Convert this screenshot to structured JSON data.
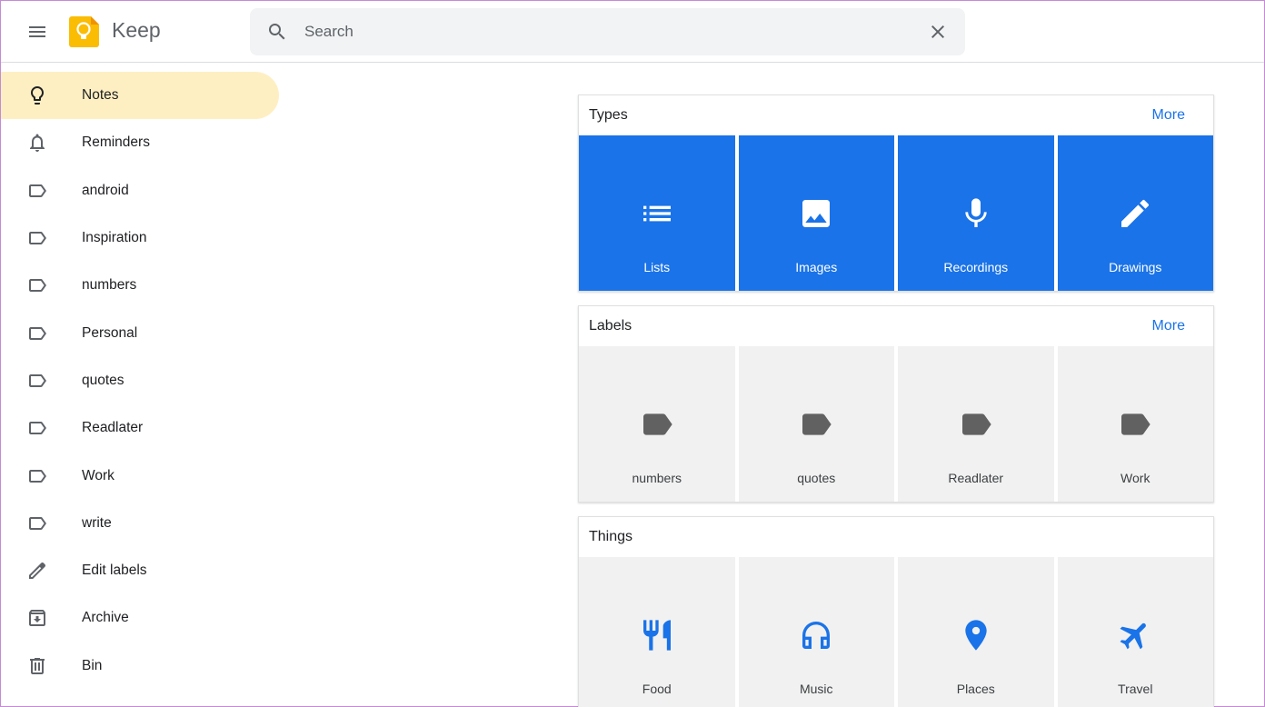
{
  "app": {
    "title": "Keep"
  },
  "search": {
    "placeholder": "Search",
    "value": ""
  },
  "sidebar": {
    "items": [
      {
        "label": "Notes",
        "icon": "lightbulb-icon",
        "active": true
      },
      {
        "label": "Reminders",
        "icon": "bell-icon"
      },
      {
        "label": "android",
        "icon": "label-icon"
      },
      {
        "label": "Inspiration",
        "icon": "label-icon"
      },
      {
        "label": "numbers",
        "icon": "label-icon"
      },
      {
        "label": "Personal",
        "icon": "label-icon"
      },
      {
        "label": "quotes",
        "icon": "label-icon"
      },
      {
        "label": "Readlater",
        "icon": "label-icon"
      },
      {
        "label": "Work",
        "icon": "label-icon"
      },
      {
        "label": "write",
        "icon": "label-icon"
      },
      {
        "label": "Edit labels",
        "icon": "pencil-icon"
      },
      {
        "label": "Archive",
        "icon": "archive-icon"
      },
      {
        "label": "Bin",
        "icon": "trash-icon"
      }
    ]
  },
  "types": {
    "title": "Types",
    "more": "More",
    "tiles": [
      {
        "label": "Lists",
        "icon": "list-icon"
      },
      {
        "label": "Images",
        "icon": "image-icon"
      },
      {
        "label": "Recordings",
        "icon": "microphone-icon"
      },
      {
        "label": "Drawings",
        "icon": "pen-icon"
      }
    ]
  },
  "labels": {
    "title": "Labels",
    "more": "More",
    "tiles": [
      {
        "label": "numbers",
        "icon": "label-tag-icon"
      },
      {
        "label": "quotes",
        "icon": "label-tag-icon"
      },
      {
        "label": "Readlater",
        "icon": "label-tag-icon"
      },
      {
        "label": "Work",
        "icon": "label-tag-icon"
      }
    ]
  },
  "things": {
    "title": "Things",
    "tiles": [
      {
        "label": "Food",
        "icon": "fork-knife-icon"
      },
      {
        "label": "Music",
        "icon": "headphones-icon"
      },
      {
        "label": "Places",
        "icon": "map-pin-icon"
      },
      {
        "label": "Travel",
        "icon": "airplane-icon"
      }
    ]
  },
  "colors": {
    "accent": "#1a73e8",
    "active_bg": "#feefc3",
    "tile_grey": "#f1f1f1",
    "logo_yellow": "#fbbc04"
  }
}
